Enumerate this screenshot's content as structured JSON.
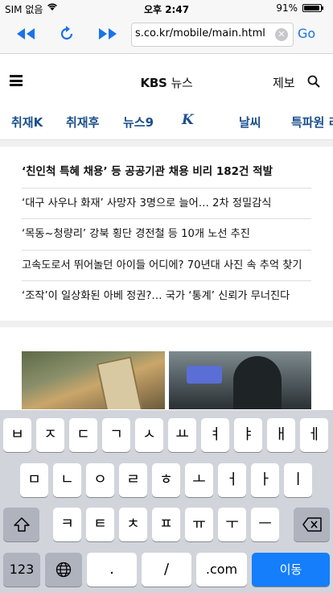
{
  "status": {
    "carrier": "SIM 없음",
    "time": "오후 2:47",
    "battery_pct": "91%",
    "battery_level": 0.91
  },
  "browser": {
    "back_icon": "rewind-icon",
    "reload_icon": "reload-icon",
    "forward_icon": "fast-forward-icon",
    "url": "s.co.kr/mobile/main.html",
    "go_label": "Go",
    "accent": "#1a73e8"
  },
  "site": {
    "logo_brand": "KBS",
    "logo_sub": "뉴스",
    "report_label": "제보"
  },
  "categories": [
    "취재K",
    "취재후",
    "뉴스9",
    "K",
    "날씨",
    "특파원 리"
  ],
  "headlines": [
    "‘친인척 특혜 채용’ 등 공공기관 채용 비리 182건 적발",
    "‘대구 사우나 화재’ 사망자 3명으로 늘어… 2차 정밀감식",
    "‘목동~청량리’ 강북 횡단 경전철 등 10개 노선 추진",
    "고속도로서 뛰어놀던 아이들 어디에? 70년대 사진 속 추억 찾기",
    "‘조작’이 일상화된 아베 정권?… 국가 ‘통계’ 신뢰가 무너진다"
  ],
  "keyboard": {
    "row1": [
      "ㅂ",
      "ㅈ",
      "ㄷ",
      "ㄱ",
      "ㅅ",
      "ㅛ",
      "ㅕ",
      "ㅑ",
      "ㅐ",
      "ㅔ"
    ],
    "row2": [
      "ㅁ",
      "ㄴ",
      "ㅇ",
      "ㄹ",
      "ㅎ",
      "ㅗ",
      "ㅓ",
      "ㅏ",
      "ㅣ"
    ],
    "row3": [
      "ㅋ",
      "ㅌ",
      "ㅊ",
      "ㅍ",
      "ㅠ",
      "ㅜ",
      "ㅡ"
    ],
    "shift_icon": "shift-icon",
    "delete_icon": "backspace-icon",
    "numbers_label": "123",
    "globe_icon": "globe-icon",
    "dot_label": ".",
    "slash_label": "/",
    "com_label": ".com",
    "go_label": "이동"
  }
}
